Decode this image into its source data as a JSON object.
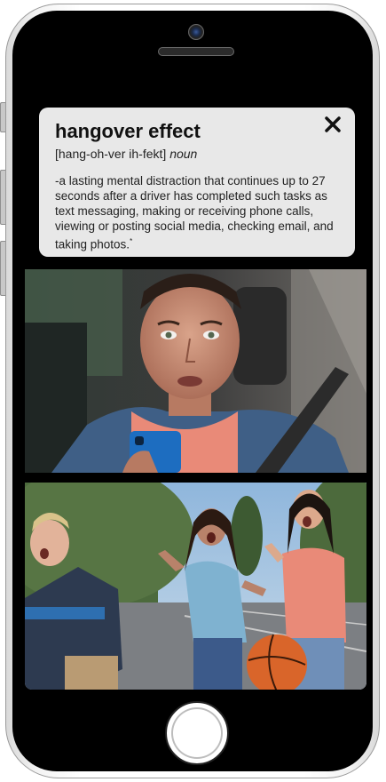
{
  "definition": {
    "term": "hangover effect",
    "pronunciation": "[hang-oh-ver ih-fekt]",
    "part_of_speech": "noun",
    "text": "-a lasting mental distraction that continues up to 27 seconds after a driver has completed such tasks as text messaging, making or receiving phone calls, viewing or posting social media, checking email, and taking photos.",
    "footnote_mark": "*"
  },
  "icons": {
    "close": "close-icon",
    "camera": "front-camera-icon",
    "home": "home-button"
  },
  "media": [
    {
      "name": "driver-looking-up-from-phone"
    },
    {
      "name": "teens-startled-in-parking-lot"
    }
  ],
  "colors": {
    "card_bg": "#e8e8e8",
    "bezel": "#000000",
    "shirt_coral": "#e98a78"
  }
}
